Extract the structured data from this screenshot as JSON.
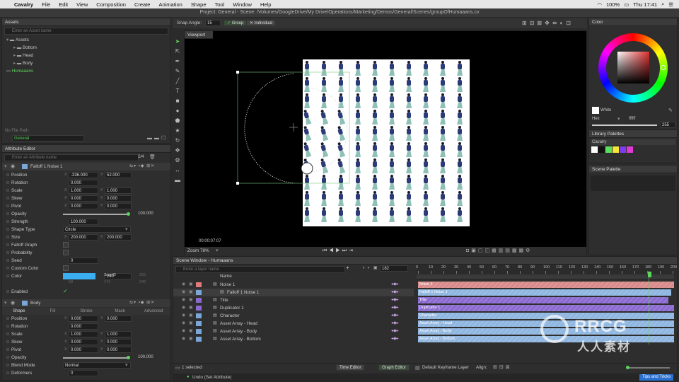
{
  "menubar": {
    "app": "Cavalry",
    "items": [
      "File",
      "Edit",
      "View",
      "Composition",
      "Create",
      "Animation",
      "Shape",
      "Tool",
      "Window",
      "Help"
    ],
    "battery": "100%",
    "clock": "Thu 17:41"
  },
  "window_title": "Project: General - Scene: /Volumes/GoogleDrive/My Drive/Operations/Marketing/Demos/General/Scenes/groupOfHumaaans.cv",
  "assets": {
    "title": "Assets",
    "search_placeholder": "Enter an Asset name",
    "tree": [
      {
        "label": "Assets",
        "depth": 0
      },
      {
        "label": "Bottom",
        "depth": 1
      },
      {
        "label": "Head",
        "depth": 1
      },
      {
        "label": "Body",
        "depth": 1
      },
      {
        "label": "Humaaans",
        "depth": 0,
        "selected": true
      }
    ],
    "file_path_label": "No File Path",
    "folder_value": "General"
  },
  "attribute_editor": {
    "title": "Attribute Editor",
    "search_placeholder": "Enter an Attribute name",
    "count": "2/4",
    "layer1": {
      "name": "Falloff 1 Noise 1",
      "rows": [
        {
          "label": "Position",
          "a_pre": "X",
          "a": "-336.000",
          "b_pre": "Y",
          "b": "52.000"
        },
        {
          "label": "Rotation",
          "a": "0.000"
        },
        {
          "label": "Scale",
          "a_pre": "X",
          "a": "1.000",
          "b_pre": "Y",
          "b": "1.000"
        },
        {
          "label": "Skew",
          "a_pre": "X",
          "a": "0.000",
          "b_pre": "Y",
          "b": "0.000"
        },
        {
          "label": "Pivot",
          "a_pre": "X",
          "a": "0.000",
          "b_pre": "Y",
          "b": "0.000"
        },
        {
          "label": "Opacity",
          "slider": "100.000"
        },
        {
          "label": "Strength",
          "a": "100.000"
        },
        {
          "label": "Shape Type",
          "select": "Circle"
        },
        {
          "label": "Size",
          "a_pre": "X",
          "a": "200.000",
          "b_pre": "Y",
          "b": "200.000"
        },
        {
          "label": "Falloff Graph"
        },
        {
          "label": "Probability"
        },
        {
          "label": "Seed",
          "a": "0"
        },
        {
          "label": "Custom Color"
        },
        {
          "label": "Color",
          "hex": "3aaef0",
          "r": "58",
          "g": "174",
          "b": "240",
          "alpha": "255"
        },
        {
          "label": "Enabled"
        }
      ]
    },
    "layer2": {
      "name": "Body",
      "tabs": [
        "Shape",
        "Fill",
        "Stroke",
        "Mask",
        "Advanced"
      ],
      "rows": [
        {
          "label": "Position",
          "a_pre": "X",
          "a": "0.000",
          "b_pre": "Y",
          "b": "0.000"
        },
        {
          "label": "Rotation",
          "a": "0.000"
        },
        {
          "label": "Scale",
          "a_pre": "X",
          "a": "1.000",
          "b_pre": "Y",
          "b": "1.000"
        },
        {
          "label": "Skew",
          "a_pre": "X",
          "a": "0.000",
          "b_pre": "Y",
          "b": "0.000"
        },
        {
          "label": "Pivot",
          "a_pre": "X",
          "a": "0.000",
          "b_pre": "Y",
          "b": "0.000"
        },
        {
          "label": "Opacity",
          "slider": "100.000"
        },
        {
          "label": "Blend Mode",
          "select": "Normal"
        },
        {
          "label": "Deformers",
          "a": "0"
        }
      ]
    }
  },
  "toolbar": {
    "snap_label": "Snap Angle:",
    "snap_value": "15",
    "group_label": "Group",
    "individual_label": "Individual"
  },
  "viewport": {
    "title": "Viewport",
    "timecode": "00:00:07:07",
    "zoom_label": "Zoom",
    "zoom_value": "78%"
  },
  "color_panel": {
    "title": "Color",
    "swatch_name": "White",
    "mode": "Hex",
    "hex_value": "ffffff",
    "alpha_value": "255"
  },
  "library_palettes": {
    "title": "Library Palettes",
    "palette_name": "Cavalry",
    "swatches": [
      "#ffffff",
      "#111111",
      "#5be05b",
      "#f5e63a",
      "#7b3cf0",
      "#e03ad6"
    ]
  },
  "scene_palette": {
    "title": "Scene Palette"
  },
  "scene_window": {
    "title": "Scene Window - Humaaans",
    "search_placeholder": "Enter a layer name",
    "frame": "182",
    "name_header": "Name",
    "layers": [
      {
        "name": "Noise 1",
        "color": "#e07a7a",
        "indent": 0
      },
      {
        "name": "Falloff 1 Noise 1",
        "color": "#7aa6d8",
        "indent": 1
      },
      {
        "name": "Title",
        "color": "#8a6ad0",
        "indent": 0
      },
      {
        "name": "Duplicator 1",
        "color": "#8a6ad0",
        "indent": 0
      },
      {
        "name": "Character",
        "color": "#7aa6d8",
        "indent": 0
      },
      {
        "name": "Asset Array - Head",
        "color": "#7aa6d8",
        "indent": 0
      },
      {
        "name": "Asset Array - Body",
        "color": "#7aa6d8",
        "indent": 0
      },
      {
        "name": "Asset Array - Bottom",
        "color": "#7aa6d8",
        "indent": 0
      }
    ],
    "status": "1 selected",
    "time_editor_label": "Time Editor",
    "graph_editor_label": "Graph Editor"
  },
  "timeline": {
    "ticks": [
      "0",
      "10",
      "20",
      "30",
      "40",
      "50",
      "60",
      "70",
      "80",
      "90",
      "100",
      "110",
      "120",
      "130",
      "140",
      "150",
      "160",
      "170",
      "180",
      "190",
      "200"
    ],
    "keyframe_layer_label": "Default Keyframe Layer",
    "align_label": "Align:"
  },
  "footer": {
    "undo_text": "Undo (Set Attribute)",
    "tips_label": "Tips and Tricks"
  },
  "watermark": {
    "brand": "RRCG",
    "chinese": "人人素材"
  },
  "colors": {
    "accent_blue": "#3aaef0",
    "selected_green": "#5bd65b",
    "noise_bar": "#d98a8a",
    "blue_bar": "#8fb6e0",
    "purple_bar": "#8a6ad0"
  }
}
